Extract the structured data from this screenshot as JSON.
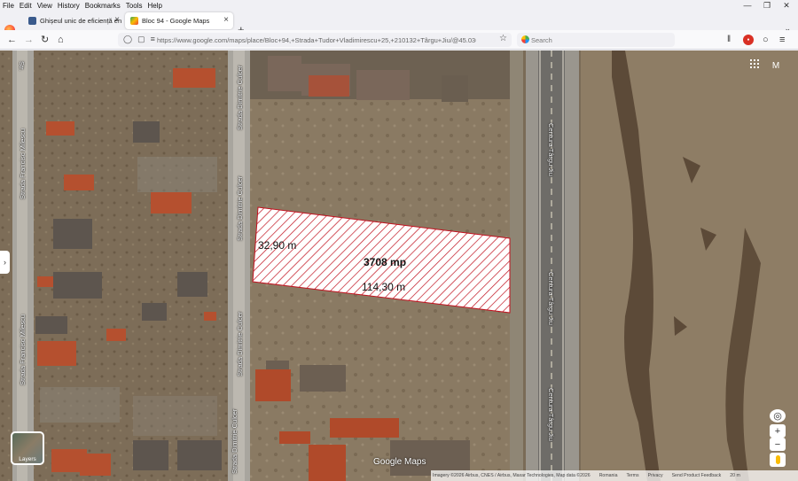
{
  "menu": [
    "File",
    "Edit",
    "View",
    "History",
    "Bookmarks",
    "Tools",
    "Help"
  ],
  "tabs": [
    {
      "title": "Ghișeul unic de eficiență ener…",
      "active": false
    },
    {
      "title": "Bloc 94 - Google Maps",
      "active": true
    }
  ],
  "urlbar": {
    "url": "https://www.google.com/maps/place/Bloc+94,+Strada+Tudor+Vladimirescu+25,+210132+Târgu+Jiu/@45.03646"
  },
  "searchbar": {
    "placeholder": "Search"
  },
  "map": {
    "streets": [
      "Strada Francisc Milescu",
      "Strada Francisc Milescu",
      "Strada Dimitrie Culcer",
      "Strada Dimitrie Culcer",
      "Strada Dimitrie Culcer",
      "Strada Dimitrie Culcer",
      "Centura Târgu Jiu",
      "Centura Târgu Jiu",
      "Centura Târgu Jiu",
      "Str."
    ],
    "measurements": {
      "width": "32,90 m",
      "area": "3708 mp",
      "length": "114,30 m"
    },
    "account_initial": "M",
    "layers_label": "Layers",
    "brand": "Google Maps",
    "attribution": [
      "Imagery ©2026 Airbus, CNES / Airbus, Maxar Technologies, Map data ©2026",
      "Romania",
      "Terms",
      "Privacy",
      "Send Product Feedback",
      "20 m"
    ]
  },
  "colors": {
    "parcel_hatch": "#c1121f",
    "parcel_fill": "#ffffff"
  }
}
